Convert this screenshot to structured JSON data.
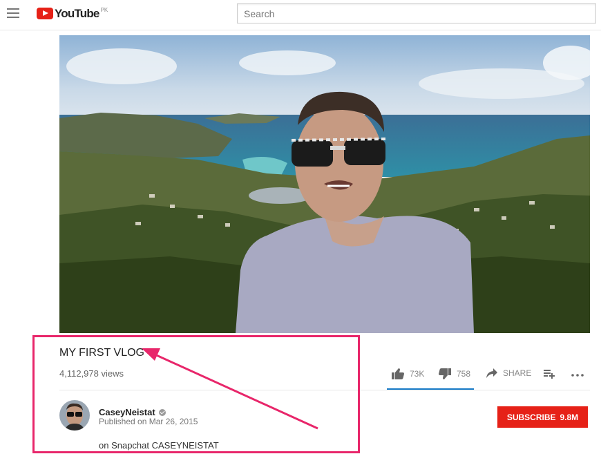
{
  "masthead": {
    "logo_text": "YouTube",
    "country_code": "PK",
    "search_placeholder": "Search"
  },
  "video": {
    "title": "MY FIRST VLOG",
    "views": "4,112,978 views"
  },
  "actions": {
    "likes": "73K",
    "dislikes": "758",
    "share_label": "SHARE"
  },
  "channel": {
    "name": "CaseyNeistat",
    "published": "Published on Mar 26, 2015",
    "description": "on Snapchat CASEYNEISTAT"
  },
  "subscribe": {
    "label": "SUBSCRIBE",
    "count": "9.8M"
  },
  "colors": {
    "brand_red": "#e62117",
    "annotation_pink": "#e8266a",
    "selected_blue": "#167ac6"
  },
  "icons": [
    "menu-icon",
    "youtube-logo-icon",
    "thumbs-up-icon",
    "thumbs-down-icon",
    "share-icon",
    "add-to-playlist-icon",
    "more-icon",
    "verified-icon"
  ]
}
